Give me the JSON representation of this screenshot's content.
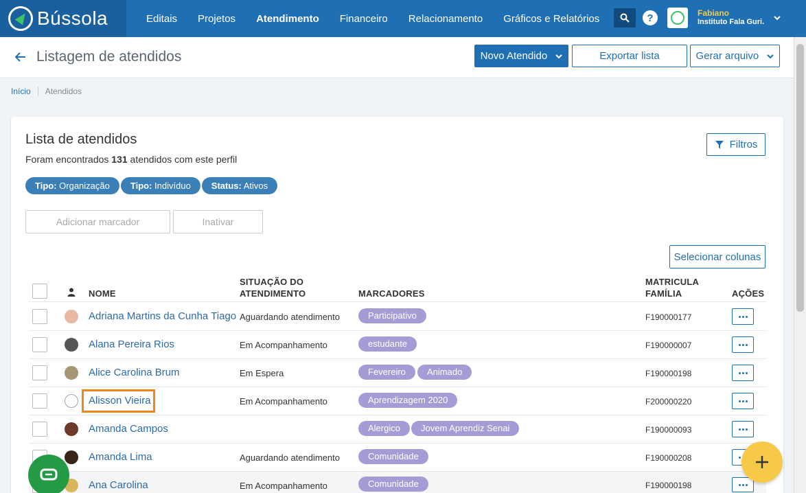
{
  "brand": {
    "name": "Bússola"
  },
  "nav": {
    "items": [
      "Editais",
      "Projetos",
      "Atendimento",
      "Financeiro",
      "Relacionamento",
      "Gráficos e Relatórios"
    ],
    "active": "Atendimento"
  },
  "user": {
    "name": "Fabiano",
    "org": "Instituto Fala Guri."
  },
  "header": {
    "title": "Listagem de atendidos",
    "new_button": "Novo Atendido",
    "export_button": "Exportar lista",
    "generate_button": "Gerar arquivo"
  },
  "breadcrumb": {
    "home": "Início",
    "current": "Atendidos"
  },
  "card": {
    "title": "Lista de atendidos",
    "found_prefix": "Foram encontrados",
    "found_count": "131",
    "found_suffix": "atendidos com este perfil",
    "filters_button": "Filtros",
    "chips": [
      {
        "key": "Tipo:",
        "value": "Organização"
      },
      {
        "key": "Tipo:",
        "value": "Indivíduo"
      },
      {
        "key": "Status:",
        "value": "Ativos"
      }
    ],
    "add_marker_button": "Adicionar marcador",
    "deactivate_button": "Inativar",
    "select_columns_button": "Selecionar colunas"
  },
  "table": {
    "headers": {
      "name": "NOME",
      "situation_line1": "SITUAÇÃO DO",
      "situation_line2": "ATENDIMENTO",
      "markers": "MARCADORES",
      "matricula_line1": "MATRICULA",
      "matricula_line2": "FAMÍLIA",
      "actions": "AÇÕES"
    },
    "rows": [
      {
        "name": "Adriana Martins da Cunha Tiago",
        "situation": "Aguardando atendimento",
        "tags": [
          "Participativo"
        ],
        "matricula": "F190000177"
      },
      {
        "name": "Alana Pereira Rios",
        "situation": "Em Acompanhamento",
        "tags": [
          "estudante"
        ],
        "matricula": "F190000007"
      },
      {
        "name": "Alice Carolina Brum",
        "situation": "Em Espera",
        "tags": [
          "Fevereiro",
          "Animado"
        ],
        "matricula": "F190000198"
      },
      {
        "name": "Alisson Vieira",
        "situation": "Em Acompanhamento",
        "tags": [
          "Aprendizagem 2020"
        ],
        "matricula": "F200000220"
      },
      {
        "name": "Amanda Campos",
        "situation": "",
        "tags": [
          "Alergico",
          "Jovem Aprendiz Senai"
        ],
        "matricula": "F190000093"
      },
      {
        "name": "Amanda Lima",
        "situation": "Aguardando atendimento",
        "tags": [
          "Comunidade"
        ],
        "matricula": "F190000208"
      },
      {
        "name": "Ana Carolina",
        "situation": "Em Acompanhamento",
        "tags": [
          "Comunidade"
        ],
        "matricula": "F190000198"
      }
    ]
  },
  "colors": {
    "primary": "#1f6fb5",
    "tag": "#a79bd6",
    "fab": "#f7c948",
    "chat": "#249a44",
    "highlight": "#f0851e"
  }
}
